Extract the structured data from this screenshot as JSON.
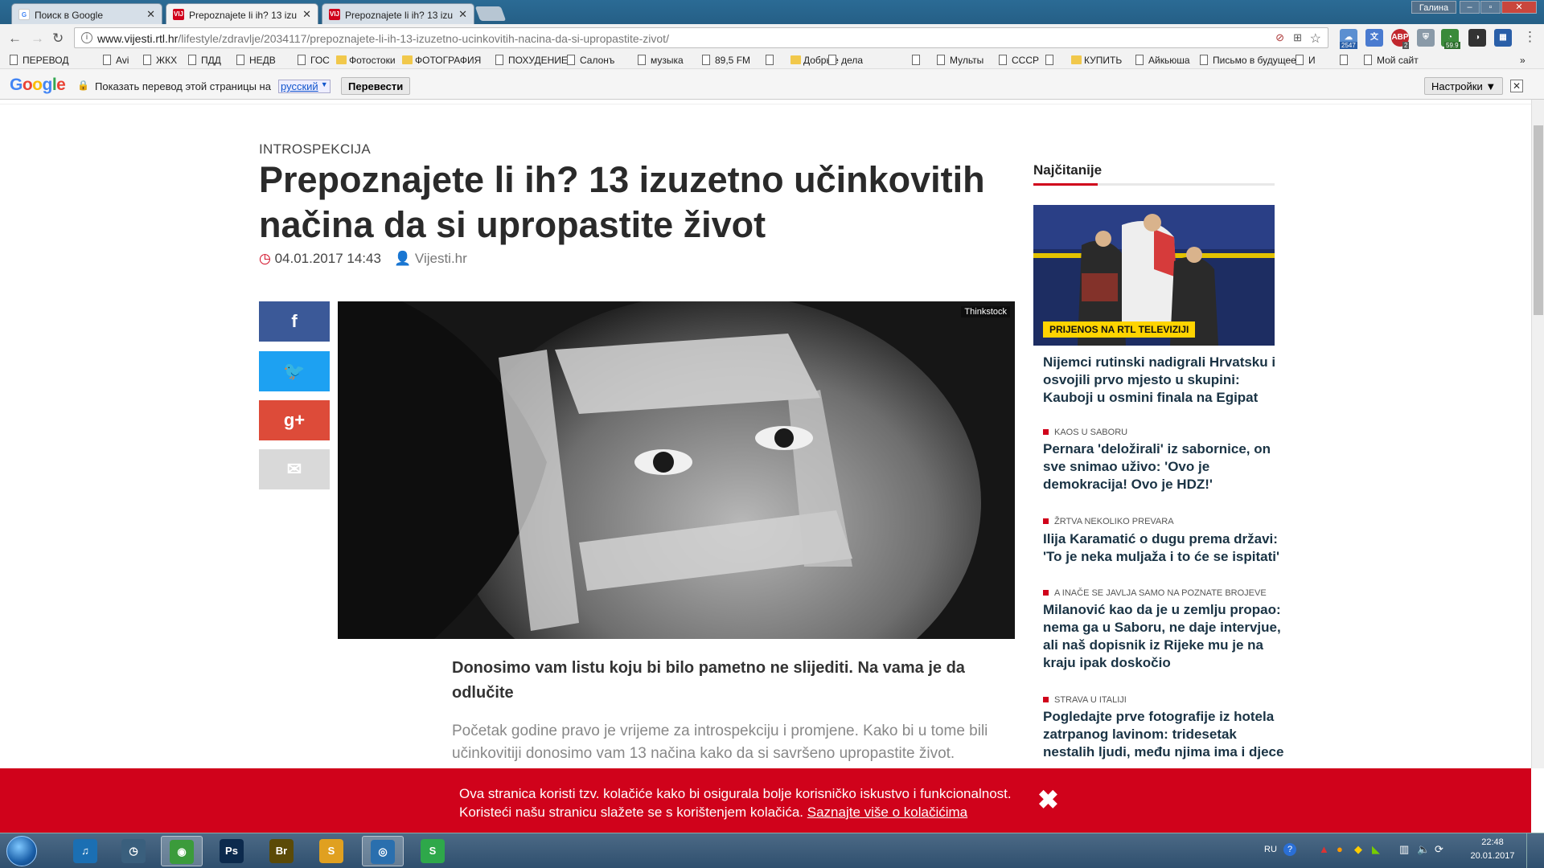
{
  "browser": {
    "tabs": [
      {
        "title": "Поиск в Google",
        "active": false
      },
      {
        "title": "Prepoznajete li ih? 13 izu",
        "active": true
      },
      {
        "title": "Prepoznajete li ih? 13 izu",
        "active": false
      }
    ],
    "window_user": "Галина",
    "url_host": "www.vijesti.rtl.hr",
    "url_path": "/lifestyle/zdravlje/2034117/prepoznajete-li-ih-13-izuzetno-ucinkovitih-nacina-da-si-upropastite-zivot/",
    "extension_badges": {
      "ext1": "2547",
      "abp": "2",
      "ext3": "59.9"
    }
  },
  "bookmarks": [
    {
      "label": "ПЕРЕВОД",
      "kind": "page"
    },
    {
      "label": "Avi",
      "kind": "page"
    },
    {
      "label": "ЖКХ",
      "kind": "page"
    },
    {
      "label": "ПДД",
      "kind": "page"
    },
    {
      "label": "НЕДВ",
      "kind": "page"
    },
    {
      "label": "ГОС",
      "kind": "page"
    },
    {
      "label": "Фотостоки",
      "kind": "folder"
    },
    {
      "label": "ФОТОГРАФИЯ",
      "kind": "folder"
    },
    {
      "label": "ПОХУДЕНИЕ",
      "kind": "page"
    },
    {
      "label": "Салонъ",
      "kind": "page"
    },
    {
      "label": "музыка",
      "kind": "page"
    },
    {
      "label": "89,5 FM",
      "kind": "page"
    },
    {
      "label": "",
      "kind": "page"
    },
    {
      "label": "Добрые дела",
      "kind": "folder"
    },
    {
      "label": "",
      "kind": "page"
    },
    {
      "label": "",
      "kind": "page"
    },
    {
      "label": "Мульты",
      "kind": "page"
    },
    {
      "label": "СССР",
      "kind": "page"
    },
    {
      "label": "",
      "kind": "page"
    },
    {
      "label": "КУПИТЬ",
      "kind": "folder"
    },
    {
      "label": "Айкьюша",
      "kind": "page"
    },
    {
      "label": "Письмо в будущее",
      "kind": "page"
    },
    {
      "label": "И",
      "kind": "page"
    },
    {
      "label": "",
      "kind": "page"
    },
    {
      "label": "Мой сайт",
      "kind": "page"
    }
  ],
  "translate_bar": {
    "logo": "Google",
    "text": "Показать перевод этой страницы на",
    "language": "русский",
    "translate_button": "Перевести",
    "settings_button": "Настройки ▼"
  },
  "article": {
    "category": "INTROSPEKCIJA",
    "title": "Prepoznajete li ih? 13 izuzetno učinkovitih načina da si upropastite život",
    "date": "04.01.2017 14:43",
    "author": "Vijesti.hr",
    "image_credit": "Thinkstock",
    "lead": "Donosimo vam listu koju bi bilo pametno ne slijediti. Na vama je da odlučite",
    "body": "Početak godine pravo je vrijeme za introspekciju i promjene. Kako bi u tome bili učinkovitiji donosimo vam 13 načina kako da si savršeno upropastite život. Naravno, vi"
  },
  "share_buttons": [
    {
      "icon": "facebook-icon",
      "glyph": "f",
      "color": "#3b5998"
    },
    {
      "icon": "twitter-icon",
      "glyph": "🐦",
      "color": "#1da1f2"
    },
    {
      "icon": "google-plus-icon",
      "glyph": "g+",
      "color": "#dd4b39"
    },
    {
      "icon": "mail-icon",
      "glyph": "✉",
      "color": "#d9d9d9"
    }
  ],
  "sidebar": {
    "heading": "Najčitanije",
    "image_badge": "PRIJENOS NA RTL TELEVIZIJI",
    "items": [
      {
        "kicker": "",
        "headline": "Nijemci rutinski nadigrali Hrvatsku i osvojili prvo mjesto u skupini: Kauboji u osmini finala na Egipat"
      },
      {
        "kicker": "KAOS U SABORU",
        "headline": "Pernara 'deložirali' iz sabornice, on sve snimao uživo: 'Ovo je demokracija! Ovo je HDZ!'"
      },
      {
        "kicker": "ŽRTVA NEKOLIKO PREVARA",
        "headline": "Ilija Karamatić o dugu prema državi: 'To je neka muljaža i to će se ispitati'"
      },
      {
        "kicker": "A INAČE SE JAVLJA SAMO NA POZNATE BROJEVE",
        "headline": "Milanović kao da je u zemlju propao: nema ga u Saboru, ne daje intervjue, ali naš dopisnik iz Rijeke mu je na kraju ipak doskočio"
      },
      {
        "kicker": "STRAVA U ITALIJI",
        "headline": "Pogledajte prve fotografije iz hotela zatrpanog lavinom: tridesetak nestalih ljudi, među njima ima i djece"
      }
    ]
  },
  "cookie_banner": {
    "line1": "Ova stranica koristi tzv. kolačiće kako bi osigurala bolje korisničko iskustvo i funkcionalnost.",
    "line2": "Koristeći našu stranicu slažete se s korištenjem kolačića.",
    "link": "Saznajte više o kolačićima",
    "close": "✖"
  },
  "taskbar": {
    "apps": [
      {
        "name": "itunes-icon",
        "label": "♫",
        "color": "#1b6fb3"
      },
      {
        "name": "clock-icon",
        "label": "◷",
        "color": "#3a5f7d"
      },
      {
        "name": "chrome-icon",
        "label": "◉",
        "color": "#3b9b3b"
      },
      {
        "name": "photoshop-icon",
        "label": "Ps",
        "color": "#0c2a4d"
      },
      {
        "name": "bridge-icon",
        "label": "Br",
        "color": "#5b4a07"
      },
      {
        "name": "app-s-icon",
        "label": "S",
        "color": "#e0a020"
      },
      {
        "name": "camera-app-icon",
        "label": "◎",
        "color": "#2a6fae"
      },
      {
        "name": "app-s2-icon",
        "label": "S",
        "color": "#2ea84a"
      }
    ],
    "lang": "RU",
    "time": "22:48",
    "date": "20.01.2017"
  }
}
